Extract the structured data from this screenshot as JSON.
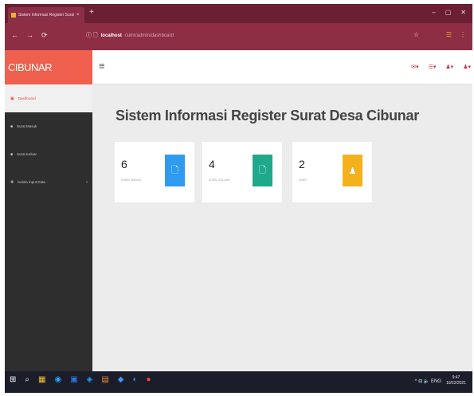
{
  "browser": {
    "tab_title": "Sistem Informasi Register Surat D",
    "tab_close": "×",
    "new_tab": "+",
    "window_controls": [
      "–",
      "▢",
      "✕"
    ],
    "nav": [
      "←",
      "→",
      "⟳"
    ],
    "url_icons": "ⓘ 🗋",
    "url_host": "localhost",
    "url_path": "/simr/admin/dashboard",
    "bookmark_star": "☆",
    "menu_icons": [
      "☰",
      "⋮"
    ]
  },
  "app": {
    "brand": "CIBUNAR",
    "menu_toggle": "≡",
    "nav_icons": [
      "✉▾",
      "☰▾",
      "♟▾",
      "♟▾"
    ],
    "page_title": "Sistem Informasi Register Surat Desa Cibunar"
  },
  "sidebar": {
    "items": [
      {
        "icon": "▣",
        "label": "Dashboard",
        "active": true
      },
      {
        "icon": "■",
        "label": "Surat Masuk",
        "active": false
      },
      {
        "icon": "■",
        "label": "Surat Keluar",
        "active": false
      },
      {
        "icon": "✚",
        "label": "Kelola Input Data",
        "active": false,
        "caret": "‹"
      }
    ]
  },
  "cards": [
    {
      "count": "6",
      "label": "SURAT MASUK",
      "icon": "🗋",
      "color": "#2f9bf0"
    },
    {
      "count": "4",
      "label": "SURAT KELUAR",
      "icon": "🗋",
      "color": "#1fa889"
    },
    {
      "count": "2",
      "label": "USER",
      "icon": "♟",
      "color": "#f3b21b"
    }
  ],
  "taskbar": {
    "left_icons": [
      "⊞",
      "⌕",
      "▦",
      "◉",
      "▣",
      "◈",
      "▤",
      "◆",
      "◐",
      "●"
    ],
    "tray": "^ ⊟ 🔈 ENG",
    "time": "9:47",
    "date": "10/22/2021"
  }
}
